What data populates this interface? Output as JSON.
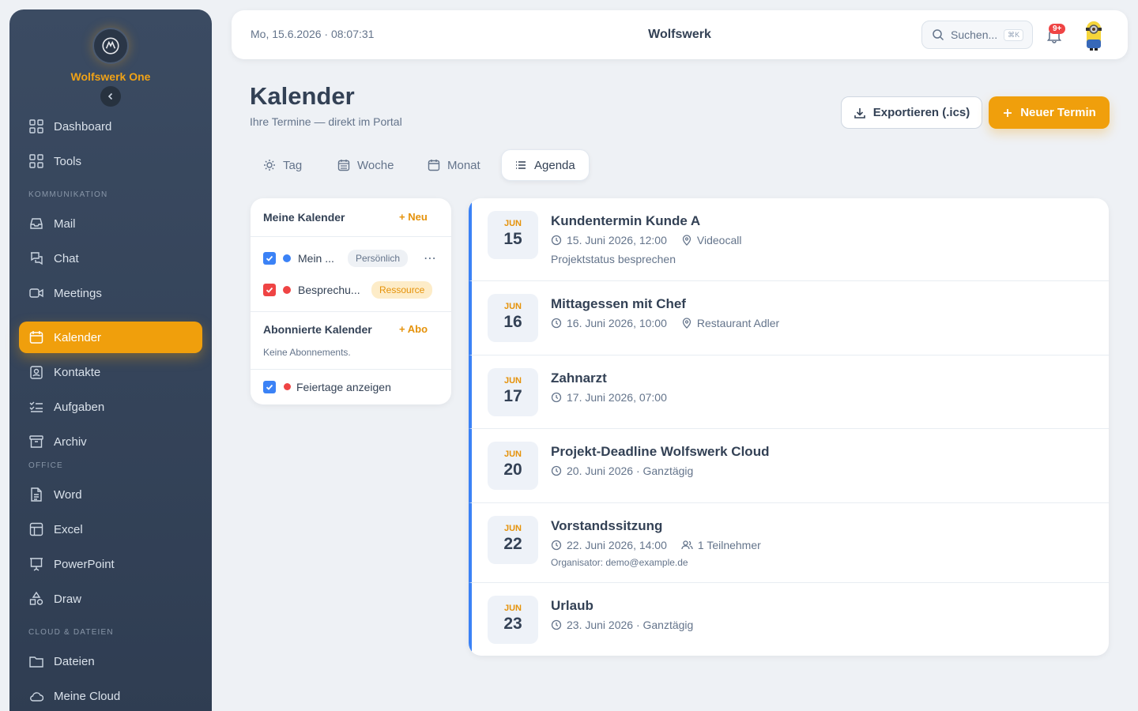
{
  "sidebar": {
    "brand": "Wolfswerk One",
    "items": [
      {
        "label": "Dashboard"
      },
      {
        "label": "Tools"
      },
      {
        "label": "Mail"
      },
      {
        "label": "Chat"
      },
      {
        "label": "Meetings"
      },
      {
        "label": "Kalender"
      },
      {
        "label": "Kontakte"
      },
      {
        "label": "Aufgaben"
      },
      {
        "label": "Archiv"
      },
      {
        "label": "Word"
      },
      {
        "label": "Excel"
      },
      {
        "label": "PowerPoint"
      },
      {
        "label": "Draw"
      },
      {
        "label": "Dateien"
      },
      {
        "label": "Meine Cloud"
      }
    ],
    "sections": [
      "KOMMUNIKATION",
      "OFFICE",
      "CLOUD & DATEIEN"
    ]
  },
  "topbar": {
    "datetime": "Mo, 15.6.2026 · 08:07:31",
    "title": "Wolfswerk",
    "search_placeholder": "Suchen...",
    "search_shortcut": "⌘K",
    "notification_badge": "9+"
  },
  "header": {
    "title": "Kalender",
    "subtitle": "Ihre Termine — direkt im Portal",
    "export_label": "Exportieren (.ics)",
    "new_label": "Neuer Termin"
  },
  "tabs": [
    {
      "label": "Tag"
    },
    {
      "label": "Woche"
    },
    {
      "label": "Monat"
    },
    {
      "label": "Agenda"
    }
  ],
  "calendars": {
    "my_title": "Meine Kalender",
    "my_add": "Neu",
    "items": [
      {
        "name": "Mein ...",
        "tag": "Persönlich",
        "color": "#3b82f6"
      },
      {
        "name": "Besprechu...",
        "tag": "Ressource",
        "color": "#ef4444"
      }
    ],
    "sub_title": "Abonnierte Kalender",
    "sub_add": "Abo",
    "sub_empty": "Keine Abonnements.",
    "holidays_label": "Feiertage anzeigen"
  },
  "agenda": [
    {
      "month": "JUN",
      "day": "15",
      "title": "Kundentermin Kunde A",
      "when": "15. Juni 2026, 12:00",
      "location": "Videocall",
      "desc": "Projektstatus besprechen"
    },
    {
      "month": "JUN",
      "day": "16",
      "title": "Mittagessen mit Chef",
      "when": "16. Juni 2026, 10:00",
      "location": "Restaurant Adler"
    },
    {
      "month": "JUN",
      "day": "17",
      "title": "Zahnarzt",
      "when": "17. Juni 2026, 07:00"
    },
    {
      "month": "JUN",
      "day": "20",
      "title": "Projekt-Deadline Wolfswerk Cloud",
      "when": "20. Juni 2026 · Ganztägig"
    },
    {
      "month": "JUN",
      "day": "22",
      "title": "Vorstandssitzung",
      "when": "22. Juni 2026, 14:00",
      "participants": "1 Teilnehmer",
      "organizer": "Organisator: demo@example.de"
    },
    {
      "month": "JUN",
      "day": "23",
      "title": "Urlaub",
      "when": "23. Juni 2026 · Ganztägig"
    }
  ],
  "colors": {
    "accent": "#f09f0c",
    "event_bar": "#3b82f6",
    "sidebar": "#34445a"
  }
}
